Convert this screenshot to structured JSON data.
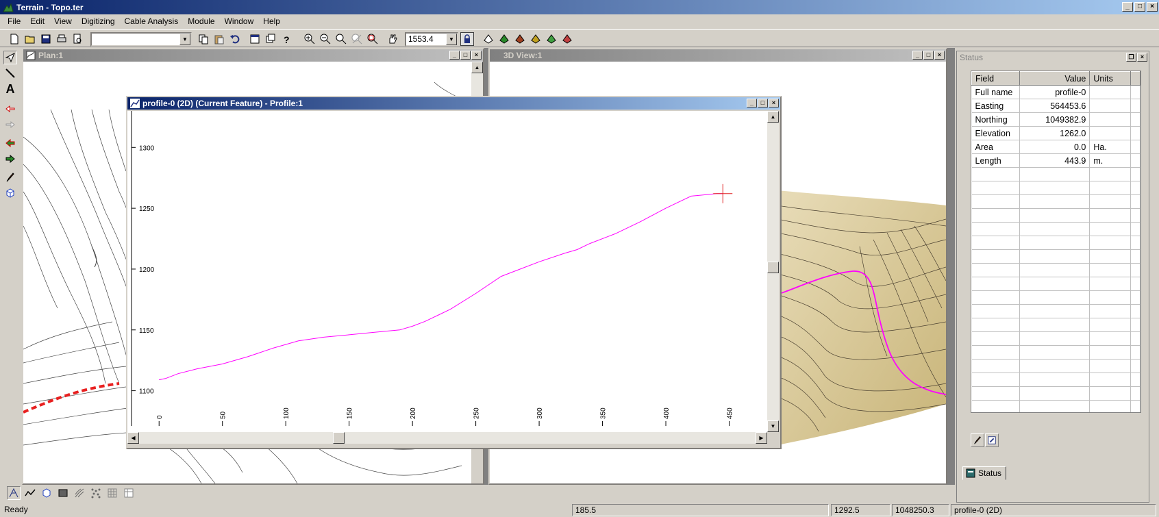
{
  "app": {
    "title": "Terrain - Topo.ter"
  },
  "window_buttons": {
    "minimize": "_",
    "maximize": "□",
    "close": "×"
  },
  "menu": [
    "File",
    "Edit",
    "View",
    "Digitizing",
    "Cable Analysis",
    "Module",
    "Window",
    "Help"
  ],
  "toolbar": {
    "layer_combo_value": "",
    "scale_value": "1553.4",
    "icons": [
      "new-file-icon",
      "open-folder-icon",
      "save-icon",
      "print-icon",
      "print-preview-icon",
      "copy-icon",
      "paste-icon",
      "undo-icon",
      "properties-icon",
      "window-icon",
      "help-icon",
      "zoom-in-icon",
      "zoom-out-icon",
      "zoom-extents-icon",
      "zoom-window-icon",
      "zoom-previous-icon",
      "pan-icon",
      "lock-icon",
      "render-1-icon",
      "render-2-icon",
      "render-3-icon",
      "render-4-icon",
      "render-5-icon",
      "render-6-icon"
    ]
  },
  "windows": {
    "plan": {
      "title": "Plan:1"
    },
    "view3d": {
      "title": "3D View:1"
    },
    "profile": {
      "title": "profile-0 (2D) (Current Feature) - Profile:1"
    },
    "status": {
      "title": "Status",
      "tab_label": "Status"
    }
  },
  "chart_data": {
    "type": "line",
    "title": "",
    "xlabel": "",
    "ylabel": "",
    "x_ticks": [
      "0",
      "50",
      "100",
      "150",
      "200",
      "250",
      "300",
      "350",
      "400",
      "450"
    ],
    "y_ticks": [
      "1100",
      "1150",
      "1200",
      "1250",
      "1300"
    ],
    "xlim": [
      -25,
      480
    ],
    "ylim": [
      1066,
      1330
    ],
    "color": "#ff00ff",
    "series": [
      {
        "x": [
          0,
          5,
          15,
          30,
          50,
          70,
          90,
          110,
          130,
          150,
          170,
          190,
          200,
          210,
          220,
          230,
          250,
          270,
          280,
          300,
          320,
          330,
          340,
          360,
          380,
          400,
          410,
          420,
          430,
          440,
          445
        ],
        "y": [
          1109,
          1110,
          1114,
          1118,
          1122,
          1128,
          1135,
          1141,
          1144,
          1146,
          1148,
          1150,
          1153,
          1157,
          1162,
          1167,
          1180,
          1194,
          1198,
          1206,
          1213,
          1216,
          1221,
          1229,
          1239,
          1250,
          1255,
          1260,
          1261,
          1262,
          1262
        ]
      }
    ],
    "cursor": {
      "x": 445,
      "y": 1262
    }
  },
  "status_table": {
    "headers": [
      "Field",
      "Value",
      "Units"
    ],
    "rows": [
      [
        "Full name",
        "profile-0",
        ""
      ],
      [
        "Easting",
        "564453.6",
        ""
      ],
      [
        "Northing",
        "1049382.9",
        ""
      ],
      [
        "Elevation",
        "1262.0",
        ""
      ],
      [
        "Area",
        "0.0",
        "Ha."
      ],
      [
        "Length",
        "443.9",
        "m."
      ]
    ],
    "empty_rows": 18
  },
  "statusbar": {
    "ready": "Ready",
    "coord1": "185.5",
    "coord2": "1292.5",
    "coord3": "1048250.3",
    "feature": "profile-0 (2D)"
  }
}
